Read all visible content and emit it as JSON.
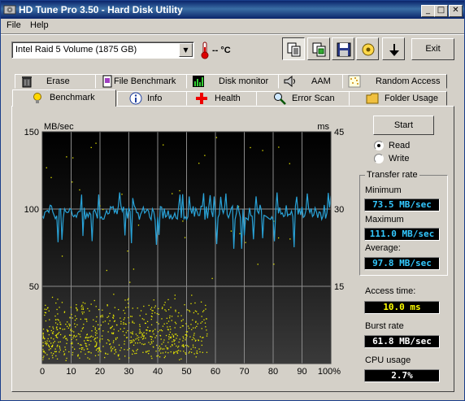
{
  "window": {
    "title": "HD Tune Pro 3.50 - Hard Disk Utility",
    "min_glyph": "_",
    "max_glyph": "□",
    "close_glyph": "✕"
  },
  "menu": {
    "file": "File",
    "help": "Help"
  },
  "toolbar": {
    "drive_select": "Intel   Raid 5 Volume (1875 GB)",
    "temperature": "-- °C",
    "exit_label": "Exit"
  },
  "tabs_row1": [
    {
      "label": "Erase",
      "icon": "trash-icon"
    },
    {
      "label": "File Benchmark",
      "icon": "document-icon"
    },
    {
      "label": "Disk monitor",
      "icon": "bar-chart-icon"
    },
    {
      "label": "AAM",
      "icon": "speaker-icon"
    },
    {
      "label": "Random Access",
      "icon": "dots-icon"
    }
  ],
  "tabs_row2": [
    {
      "label": "Benchmark",
      "icon": "lightbulb-icon",
      "active": true
    },
    {
      "label": "Info",
      "icon": "info-icon"
    },
    {
      "label": "Health",
      "icon": "health-cross-icon"
    },
    {
      "label": "Error Scan",
      "icon": "magnifier-icon"
    },
    {
      "label": "Folder Usage",
      "icon": "folder-icon"
    }
  ],
  "benchmark": {
    "start_label": "Start",
    "read_label": "Read",
    "write_label": "Write",
    "mode": "read",
    "transfer_rate_label": "Transfer rate",
    "minimum_label": "Minimum",
    "minimum_value": "73.5 MB/sec",
    "maximum_label": "Maximum",
    "maximum_value": "111.0 MB/sec",
    "average_label": "Average:",
    "average_value": "97.8 MB/sec",
    "access_time_label": "Access time:",
    "access_time_value": "10.0 ms",
    "burst_rate_label": "Burst rate",
    "burst_rate_value": "61.8 MB/sec",
    "cpu_usage_label": "CPU usage",
    "cpu_usage_value": "2.7%"
  },
  "colors": {
    "transfer_line": "#29a3d8",
    "access_dots": "#e8e800",
    "value_blue": "#33c8ff",
    "value_yellow": "#ffff00",
    "value_white": "#ffffff"
  },
  "chart_data": {
    "type": "line",
    "y_left_label": "MB/sec",
    "y_right_label": "ms",
    "y_left_ticks": [
      "150",
      "100",
      "50"
    ],
    "y_right_ticks": [
      "45",
      "30",
      "15"
    ],
    "x_ticks": [
      "0",
      "10",
      "20",
      "30",
      "40",
      "50",
      "60",
      "70",
      "80",
      "90",
      "100%"
    ],
    "ylim_left": [
      0,
      150
    ],
    "ylim_right": [
      0,
      45
    ],
    "xlim": [
      0,
      100
    ],
    "series": [
      {
        "name": "Transfer rate",
        "axis": "left",
        "summary": {
          "min": 73.5,
          "max": 111.0,
          "avg": 97.8
        }
      },
      {
        "name": "Access time",
        "axis": "right",
        "type": "scatter",
        "x_range": [
          0,
          57
        ],
        "y_range": [
          0,
          14
        ],
        "outliers_x_range": [
          0,
          90
        ]
      }
    ]
  }
}
